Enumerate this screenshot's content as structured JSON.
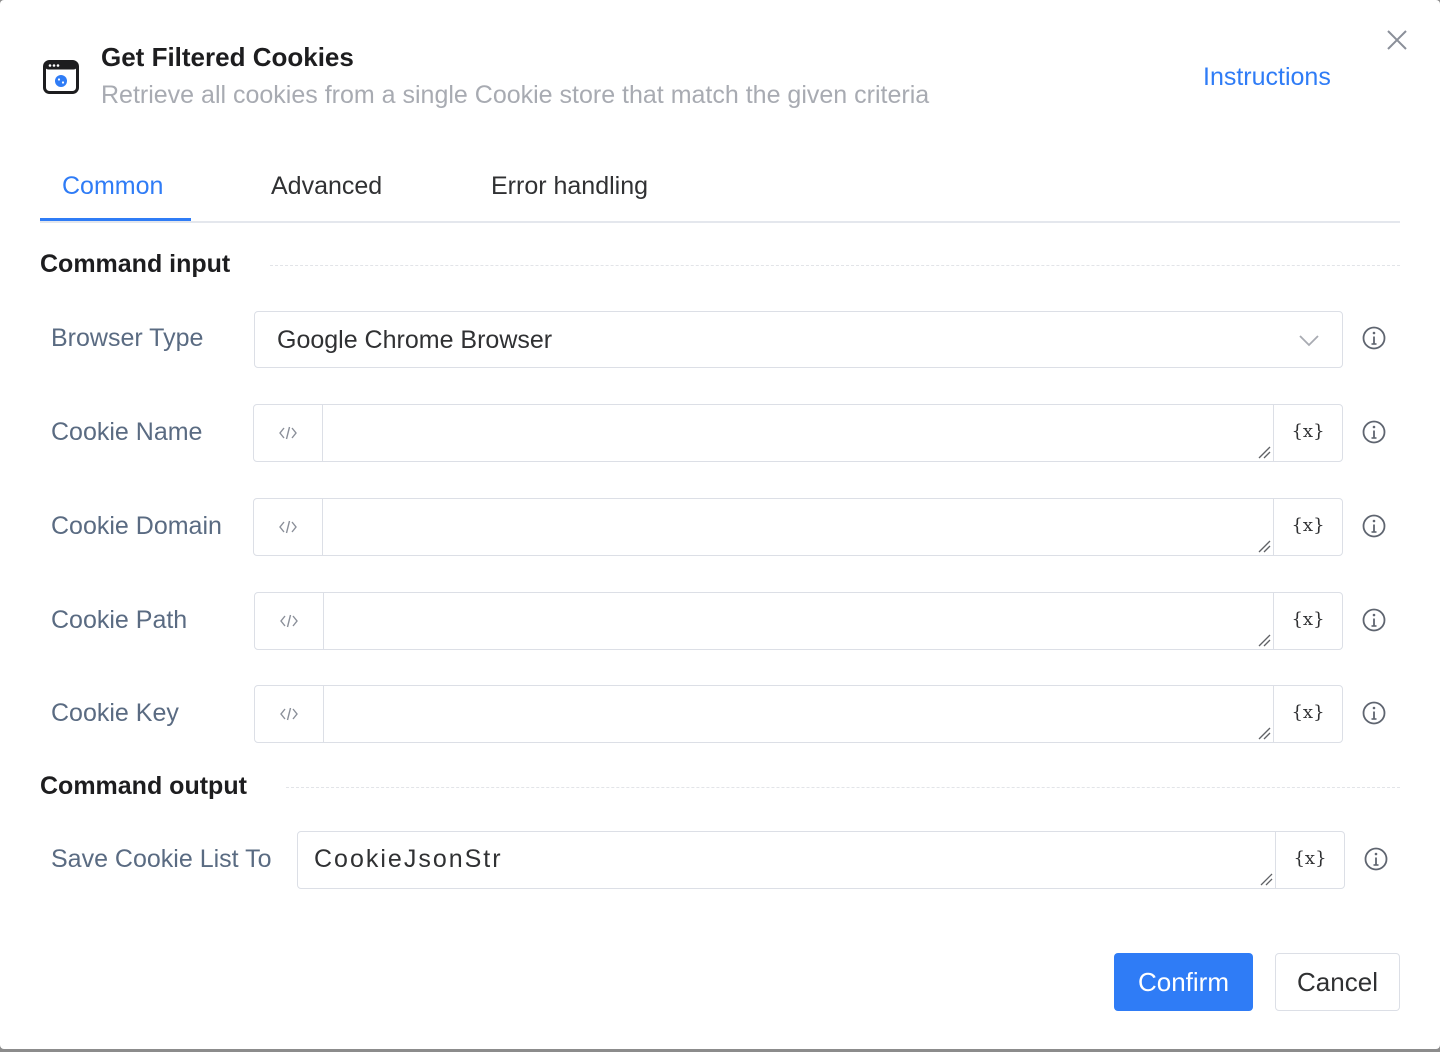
{
  "header": {
    "icon": "browser-cookie-icon",
    "title": "Get Filtered Cookies",
    "subtitle": "Retrieve all cookies from a single Cookie store that match the given criteria",
    "instructions_label": "Instructions",
    "close_icon": "close-icon"
  },
  "tabs": [
    {
      "label": "Common",
      "active": true
    },
    {
      "label": "Advanced",
      "active": false
    },
    {
      "label": "Error handling",
      "active": false
    }
  ],
  "sections": {
    "input_title": "Command input",
    "output_title": "Command output"
  },
  "fields": {
    "browser_type": {
      "label": "Browser Type",
      "value": "Google Chrome Browser"
    },
    "cookie_name": {
      "label": "Cookie Name",
      "value": ""
    },
    "cookie_domain": {
      "label": "Cookie Domain",
      "value": ""
    },
    "cookie_path": {
      "label": "Cookie Path",
      "value": ""
    },
    "cookie_key": {
      "label": "Cookie Key",
      "value": ""
    },
    "save_cookie_list": {
      "label": "Save Cookie List To",
      "value": "CookieJsonStr"
    }
  },
  "variable_button_label": "{x}",
  "buttons": {
    "confirm": "Confirm",
    "cancel": "Cancel"
  },
  "colors": {
    "accent": "#2f7cf6",
    "label": "#5a6b82",
    "subtitle": "#a8abb2"
  }
}
